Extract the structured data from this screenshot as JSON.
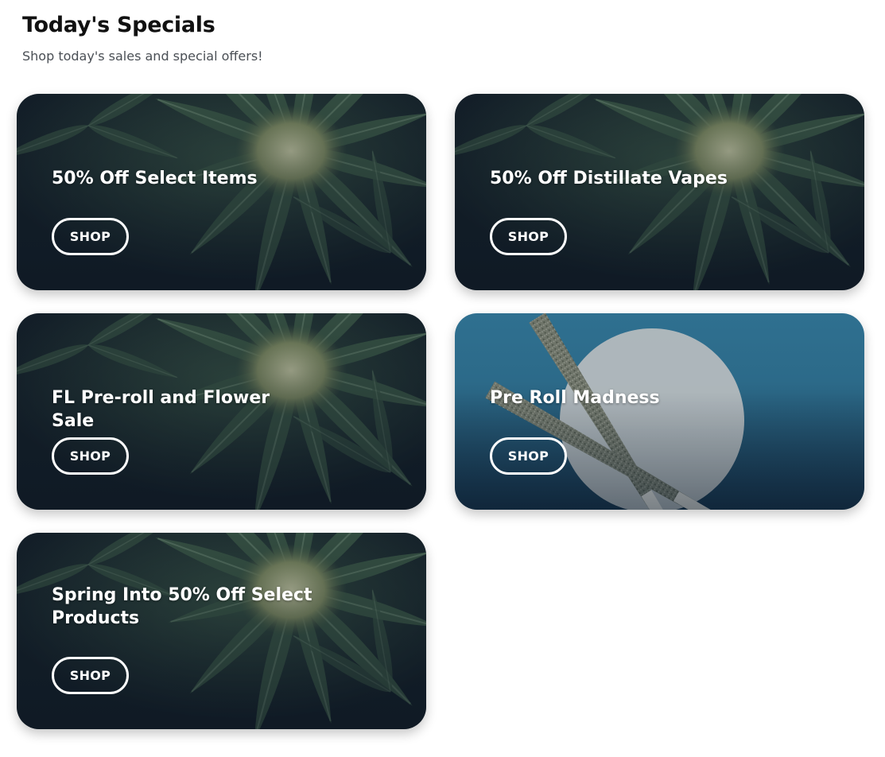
{
  "header": {
    "title": "Today's Specials",
    "subtitle": "Shop today's sales and special offers!"
  },
  "cards": [
    {
      "title": "50% Off Select Items",
      "button": "SHOP",
      "image": "cannabis-leaf-image"
    },
    {
      "title": "50% Off Distillate Vapes",
      "button": "SHOP",
      "image": "cannabis-leaf-image"
    },
    {
      "title": "FL Pre-roll and Flower Sale",
      "button": "SHOP",
      "image": "cannabis-leaf-image"
    },
    {
      "title": "Pre Roll Madness",
      "button": "SHOP",
      "image": "pre-roll-image"
    },
    {
      "title": "Spring Into 50% Off Select Products",
      "button": "SHOP",
      "image": "cannabis-leaf-image"
    }
  ],
  "colors": {
    "leaf_bg_dark": "#14222b",
    "leaf_green": "#3d5a45",
    "preroll_bg_top": "#2e6f8e",
    "preroll_bg_bottom": "#1c3f5a",
    "text": "#ffffff"
  }
}
